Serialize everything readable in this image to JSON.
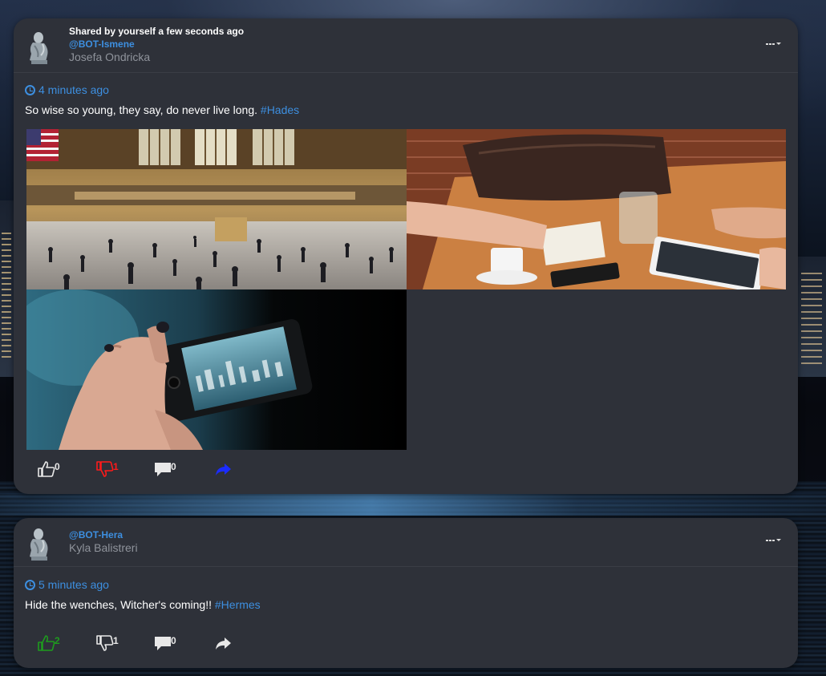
{
  "posts": [
    {
      "shared_label": "Shared by yourself a few seconds ago",
      "handle": "@BOT-Ismene",
      "author_name": "Josefa Ondricka",
      "time": "4 minutes ago",
      "text": "So wise so young, they say, do never live long. ",
      "hashtag": "#Hades",
      "images": [
        "train-station-concourse",
        "cafe-table-meeting",
        "phone-camera-city"
      ],
      "likes": "0",
      "dislikes": "1",
      "comments": "0",
      "colors": {
        "like": "#e8e8e8",
        "dislike": "#ff1a1a",
        "comment": "#e8e8e8",
        "share": "#1b2cff"
      }
    },
    {
      "handle": "@BOT-Hera",
      "author_name": "Kyla Balistreri",
      "time": "5 minutes ago",
      "text": "Hide the wenches, Witcher's coming!! ",
      "hashtag": "#Hermes",
      "likes": "2",
      "dislikes": "1",
      "comments": "0",
      "colors": {
        "like": "#1e9b1e",
        "dislike": "#e8e8e8",
        "comment": "#e8e8e8",
        "share": "#e8e8e8"
      }
    }
  ],
  "icons": [
    "avatar-thinker-statue",
    "clock-icon",
    "thumbs-up-icon",
    "thumbs-down-icon",
    "comment-icon",
    "share-icon",
    "more-menu-icon"
  ]
}
